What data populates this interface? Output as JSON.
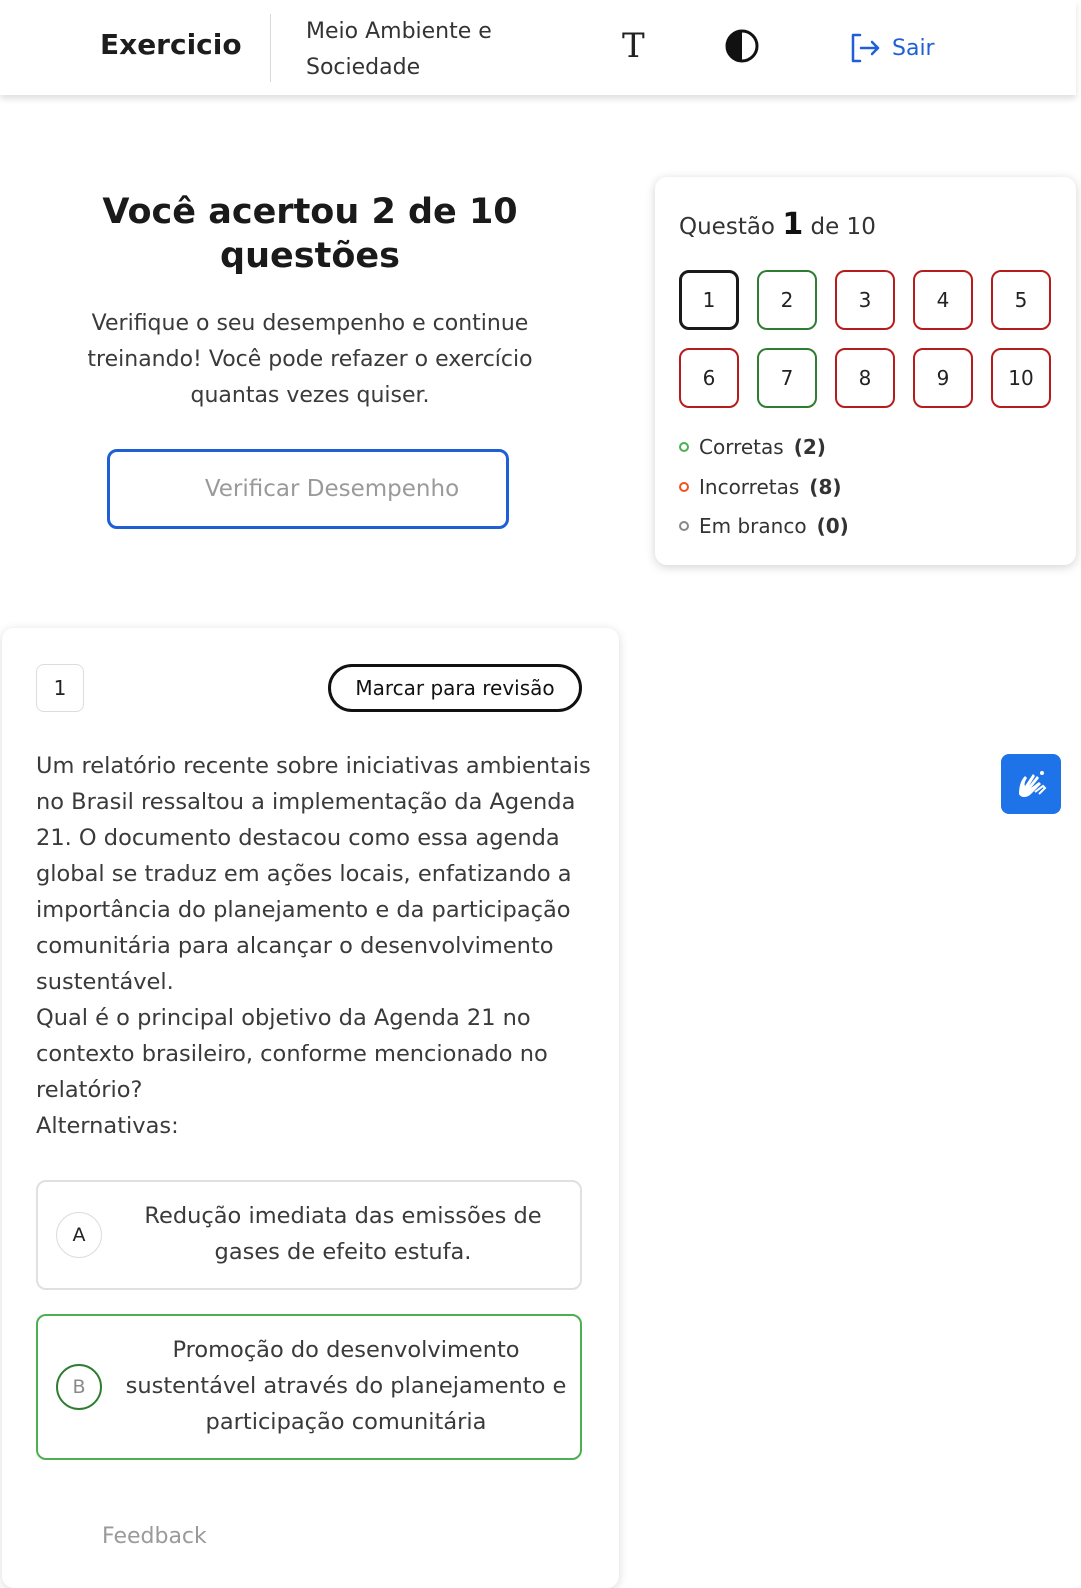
{
  "header": {
    "title": "Exercicio",
    "subject": "Meio Ambiente e Sociedade",
    "font_icon": "text-size-icon",
    "contrast_icon": "contrast-icon",
    "logout_label": "Sair"
  },
  "result": {
    "title": "Você acertou 2 de 10 questões",
    "description": "Verifique o seu desempenho e continue treinando! Você pode refazer o exercício quantas vezes quiser.",
    "button_label": "Verificar Desempenho"
  },
  "navigator": {
    "heading_prefix": "Questão",
    "current": "1",
    "heading_suffix": "de 10",
    "questions": [
      {
        "n": "1",
        "status": "current"
      },
      {
        "n": "2",
        "status": "correct"
      },
      {
        "n": "3",
        "status": "wrong"
      },
      {
        "n": "4",
        "status": "wrong"
      },
      {
        "n": "5",
        "status": "wrong"
      },
      {
        "n": "6",
        "status": "wrong"
      },
      {
        "n": "7",
        "status": "correct"
      },
      {
        "n": "8",
        "status": "wrong"
      },
      {
        "n": "9",
        "status": "wrong"
      },
      {
        "n": "10",
        "status": "wrong"
      }
    ],
    "legend": {
      "correct_label": "Corretas",
      "correct_count": "(2)",
      "incorrect_label": "Incorretas",
      "incorrect_count": "(8)",
      "blank_label": "Em branco",
      "blank_count": "(0)"
    }
  },
  "question": {
    "number": "1",
    "mark_label": "Marcar para revisão",
    "statement": "Um relatório recente sobre iniciativas ambientais no Brasil ressaltou a implementação da Agenda 21. O documento destacou como essa agenda global se traduz em ações locais, enfatizando a importância do planejamento e da participação comunitária para alcançar o desenvolvimento sustentável.",
    "prompt": "Qual é o principal objetivo da Agenda 21 no contexto brasileiro, conforme mencionado no relatório?",
    "alternatives_label": "Alternativas:",
    "alternatives": [
      {
        "letter": "A",
        "text": "Redução imediata das emissões de gases de efeito estufa."
      },
      {
        "letter": "B",
        "text": "Promoção do desenvolvimento sustentável através do planejamento e participação comunitária"
      }
    ],
    "feedback_label": "Feedback"
  },
  "colors": {
    "accent": "#1f5fd6",
    "correct": "#2e7d32",
    "wrong": "#b71c1c",
    "widget": "#1e73e8"
  },
  "accessibility_widget": {
    "icon": "sign-language-icon"
  }
}
